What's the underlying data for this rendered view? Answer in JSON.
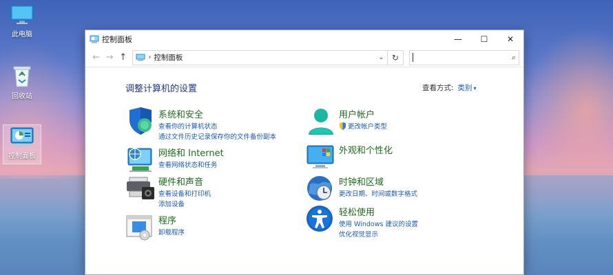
{
  "desktop": {
    "icons": [
      {
        "label": "此电脑"
      },
      {
        "label": "回收站"
      },
      {
        "label": "控制面板"
      }
    ]
  },
  "window": {
    "title": "控制面板",
    "controls": {
      "minimize": "—",
      "maximize": "☐",
      "close": "✕"
    },
    "nav": {
      "back": "←",
      "forward": "→",
      "up": "↑"
    },
    "address": {
      "crumb": "控制面板",
      "separator": "›",
      "dropdown": "⌄",
      "refresh": "↻"
    },
    "search": {
      "value": "",
      "placeholder": "",
      "icon": "⌕"
    }
  },
  "main": {
    "heading": "调整计算机的设置",
    "view_by_label": "查看方式:",
    "view_by_value": "类别",
    "view_by_arrow": "▾",
    "categories_left": [
      {
        "title": "系统和安全",
        "links": [
          "查看你的计算机状态",
          "通过文件历史记录保存你的文件备份副本"
        ]
      },
      {
        "title": "网络和 Internet",
        "links": [
          "查看网络状态和任务"
        ]
      },
      {
        "title": "硬件和声音",
        "links": [
          "查看设备和打印机",
          "添加设备"
        ]
      },
      {
        "title": "程序",
        "links": [
          "卸载程序"
        ]
      }
    ],
    "categories_right": [
      {
        "title": "用户帐户",
        "links": [
          "更改帐户类型"
        ]
      },
      {
        "title": "外观和个性化",
        "links": []
      },
      {
        "title": "时钟和区域",
        "links": [
          "更改日期、时间或数字格式"
        ]
      },
      {
        "title": "轻松使用",
        "links": [
          "使用 Windows 建议的设置",
          "优化视觉显示"
        ]
      }
    ]
  },
  "colors": {
    "heading": "#1e3a8a",
    "category_title": "#1f6b1f",
    "link": "#1c5ab8"
  }
}
